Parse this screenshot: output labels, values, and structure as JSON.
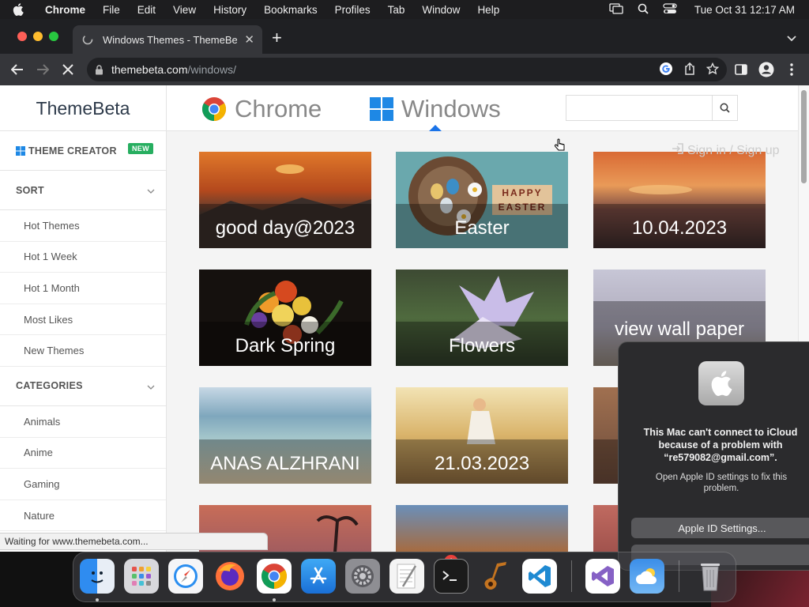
{
  "menubar": {
    "app_name": "Chrome",
    "menus": [
      "File",
      "Edit",
      "View",
      "History",
      "Bookmarks",
      "Profiles",
      "Tab",
      "Window",
      "Help"
    ],
    "clock": "Tue Oct 31  12:17 AM"
  },
  "browser": {
    "tab_title": "Windows Themes - ThemeBeta",
    "url_host": "themebeta.com",
    "url_path": "/windows/",
    "status_text": "Waiting for www.themebeta.com..."
  },
  "site": {
    "brand": "ThemeBeta",
    "nav": {
      "chrome": "Chrome",
      "windows": "Windows"
    },
    "search_placeholder": "",
    "signin": "Sign in / Sign up"
  },
  "sidebar": {
    "theme_creator": "THEME CREATOR",
    "new_badge": "NEW",
    "sort_heading": "SORT",
    "sort_items": [
      "Hot Themes",
      "Hot 1 Week",
      "Hot 1 Month",
      "Most Likes",
      "New Themes"
    ],
    "categories_heading": "CATEGORIES",
    "category_items": [
      "Animals",
      "Anime",
      "Gaming",
      "Nature"
    ]
  },
  "themes": [
    {
      "label": "good day@2023"
    },
    {
      "label": "Easter"
    },
    {
      "label": "10.04.2023"
    },
    {
      "label": "Dark Spring"
    },
    {
      "label": "Flowers"
    },
    {
      "label": "view wall paper"
    },
    {
      "label": "ANAS ALZHRANI"
    },
    {
      "label": "21.03.2023"
    }
  ],
  "easter_sign": "HAPPY EASTER",
  "notification": {
    "message": "This Mac can't connect to iCloud because of a problem with “re579082@gmail.com”.",
    "detail": "Open Apple ID settings to fix this problem.",
    "button": "Apple ID Settings..."
  },
  "dock": {
    "settings_badge": "1",
    "apps": [
      "finder-icon",
      "launchpad-icon",
      "safari-icon",
      "firefox-icon",
      "chrome-icon",
      "app-store-icon",
      "system-settings-icon",
      "textedit-icon",
      "terminal-icon",
      "garageband-icon",
      "vscode-icon",
      "visual-studio-icon",
      "weather-icon",
      "trash-icon"
    ]
  }
}
